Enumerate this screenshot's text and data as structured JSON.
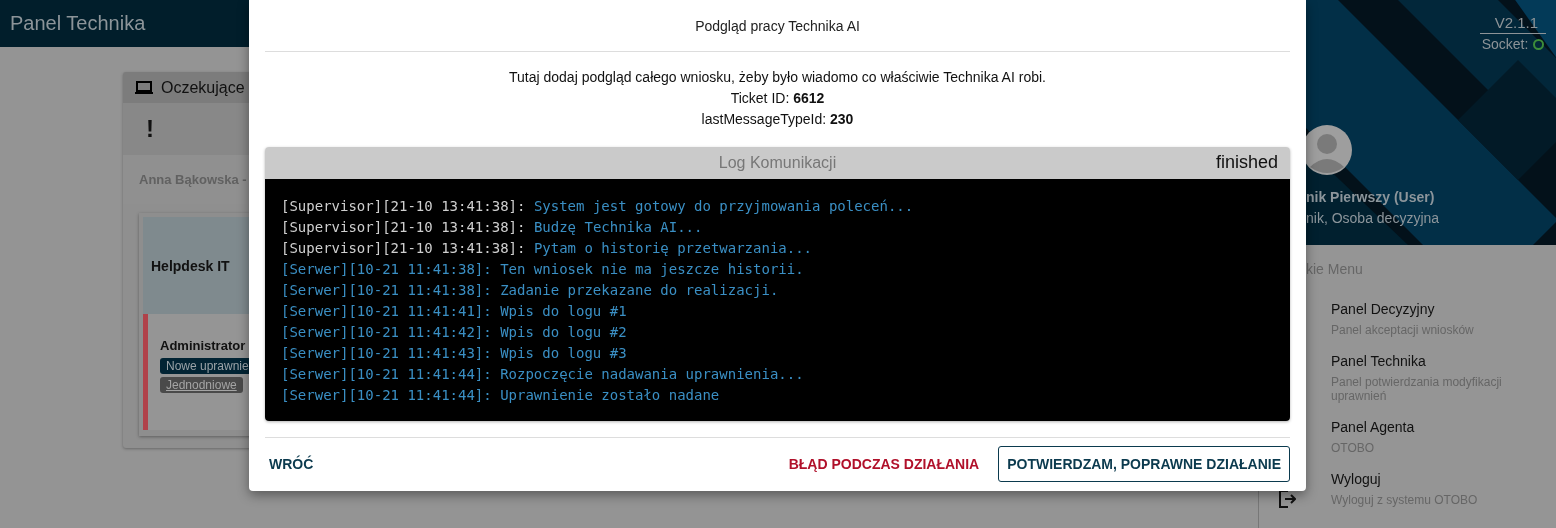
{
  "app_bar": {
    "title": "Panel Technika"
  },
  "card": {
    "title": "Oczekujące",
    "alert": "!",
    "requester": "Anna Bąkowska -",
    "group": "Helpdesk IT",
    "role": "Administrator",
    "tags": [
      {
        "label": "Nowe uprawnie",
        "kind": "filled"
      },
      {
        "label": "Jednodniowe",
        "kind": "underlined"
      }
    ]
  },
  "sidebar": {
    "version": "V2.1.1",
    "socket": {
      "label": "Socket:",
      "connected": true
    },
    "user_name": "nik Pierwszy (User)",
    "user_roles": "nik, Osoba decyzyjna",
    "menu_heading": "kie Menu",
    "items": [
      {
        "title": "Panel Decyzyjny",
        "subtitle": "Panel akceptacji wniosków"
      },
      {
        "title": "Panel Technika",
        "subtitle": "Panel potwierdzania modyfikacji uprawnień"
      },
      {
        "title": "Panel Agenta",
        "subtitle": "OTOBO"
      },
      {
        "title": "Wyloguj",
        "subtitle": "Wyloguj z systemu OTOBO",
        "kind": "logout"
      }
    ]
  },
  "dialog": {
    "title": "Podgląd pracy Technika AI",
    "lines": [
      "Tutaj dodaj podgląd całego wniosku, żeby było wiadomo co właściwie Technika AI robi.",
      "Ticket ID: **6612**",
      "lastMessageTypeId: **230**"
    ],
    "log": {
      "title": "Log Komunikacji",
      "status": "finished",
      "entries": [
        {
          "kind": "supervisor",
          "prefix": "[Supervisor][21-10 13:41:38]:",
          "message": "System jest gotowy do przyjmowania poleceń..."
        },
        {
          "kind": "supervisor",
          "prefix": "[Supervisor][21-10 13:41:38]:",
          "message": "Budzę Technika AI..."
        },
        {
          "kind": "supervisor",
          "prefix": "[Supervisor][21-10 13:41:38]:",
          "message": "Pytam o historię przetwarzania..."
        },
        {
          "kind": "server",
          "prefix": "[Serwer][10-21 11:41:38]:",
          "message": "Ten wniosek nie ma jeszcze historii."
        },
        {
          "kind": "server",
          "prefix": "[Serwer][10-21 11:41:38]:",
          "message": "Zadanie przekazane do realizacji."
        },
        {
          "kind": "server",
          "prefix": "[Serwer][10-21 11:41:41]:",
          "message": "Wpis do logu #1"
        },
        {
          "kind": "server",
          "prefix": "[Serwer][10-21 11:41:42]:",
          "message": "Wpis do logu #2"
        },
        {
          "kind": "server",
          "prefix": "[Serwer][10-21 11:41:43]:",
          "message": "Wpis do logu #3"
        },
        {
          "kind": "server",
          "prefix": "[Serwer][10-21 11:41:44]:",
          "message": "Rozpoczęcie nadawania uprawnienia..."
        },
        {
          "kind": "server",
          "prefix": "[Serwer][10-21 11:41:44]:",
          "message": "Uprawnienie zostało nadane"
        }
      ]
    },
    "buttons": [
      {
        "label": "WRÓĆ",
        "kind": "text"
      },
      {
        "label": "BŁĄD PODCZAS DZIAŁANIA",
        "kind": "danger"
      },
      {
        "label": "POTWIERDZAM, POPRAWNE DZIAŁANIE",
        "kind": "outlined"
      }
    ]
  }
}
